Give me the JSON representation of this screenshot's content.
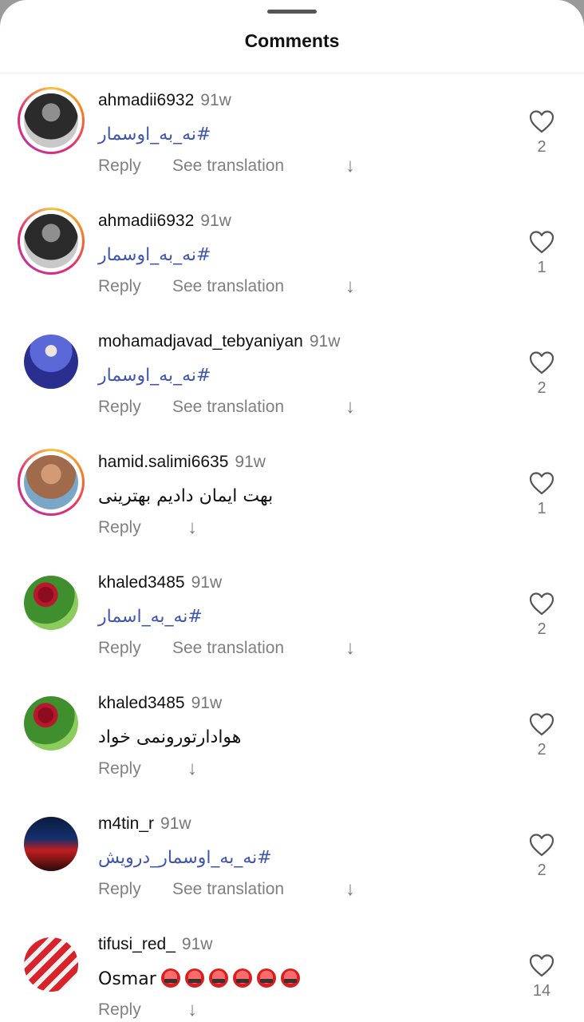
{
  "sheet": {
    "title": "Comments"
  },
  "comments": [
    {
      "username": "ahmadii6932",
      "time": "91w",
      "text": "#نه_به_اوسمار",
      "tag": true,
      "has_translation": true,
      "reply": "Reply",
      "see_translation": "See translation",
      "likes": "2",
      "avatar": "dark hooded figure",
      "ring": true
    },
    {
      "username": "ahmadii6932",
      "time": "91w",
      "text": "#نه_به_اوسمار",
      "tag": true,
      "has_translation": true,
      "reply": "Reply",
      "see_translation": "See translation",
      "likes": "1",
      "avatar": "dark hooded figure",
      "ring": true
    },
    {
      "username": "mohamadjavad_tebyaniyan",
      "time": "91w",
      "text": "#نه_به_اوسمار",
      "tag": true,
      "has_translation": true,
      "reply": "Reply",
      "see_translation": "See translation",
      "likes": "2",
      "avatar": "person in blue light",
      "ring": false
    },
    {
      "username": "hamid.salimi6635",
      "time": "91w",
      "text": "بهت ایمان دادیم بهترینی",
      "tag": false,
      "has_translation": false,
      "reply": "Reply",
      "likes": "1",
      "avatar": "man outdoors",
      "ring": true
    },
    {
      "username": "khaled3485",
      "time": "91w",
      "text": "#نه_به_اسمار",
      "tag": true,
      "has_translation": true,
      "reply": "Reply",
      "see_translation": "See translation",
      "likes": "2",
      "avatar": "red roses",
      "ring": false
    },
    {
      "username": "khaled3485",
      "time": "91w",
      "text": "هوادارتورونمی خواد",
      "tag": false,
      "has_translation": false,
      "reply": "Reply",
      "likes": "2",
      "avatar": "red roses",
      "ring": false
    },
    {
      "username": "m4tin_r",
      "time": "91w",
      "text": "#نه_به_اوسمار_درویش",
      "tag": true,
      "has_translation": true,
      "reply": "Reply",
      "see_translation": "See translation",
      "likes": "2",
      "avatar": "space landscape",
      "ring": false
    },
    {
      "username": "tifusi_red_",
      "time": "91w",
      "text": "Osmar",
      "tag": false,
      "has_translation": false,
      "reply": "Reply",
      "likes": "14",
      "avatar": "red stadium",
      "ring": false,
      "emoji_count": 6,
      "emoji": "angry-face-with-symbols-icon"
    }
  ],
  "icons": {
    "like": "heart-outline-icon",
    "translate_toggle": "arrow-down-icon"
  }
}
